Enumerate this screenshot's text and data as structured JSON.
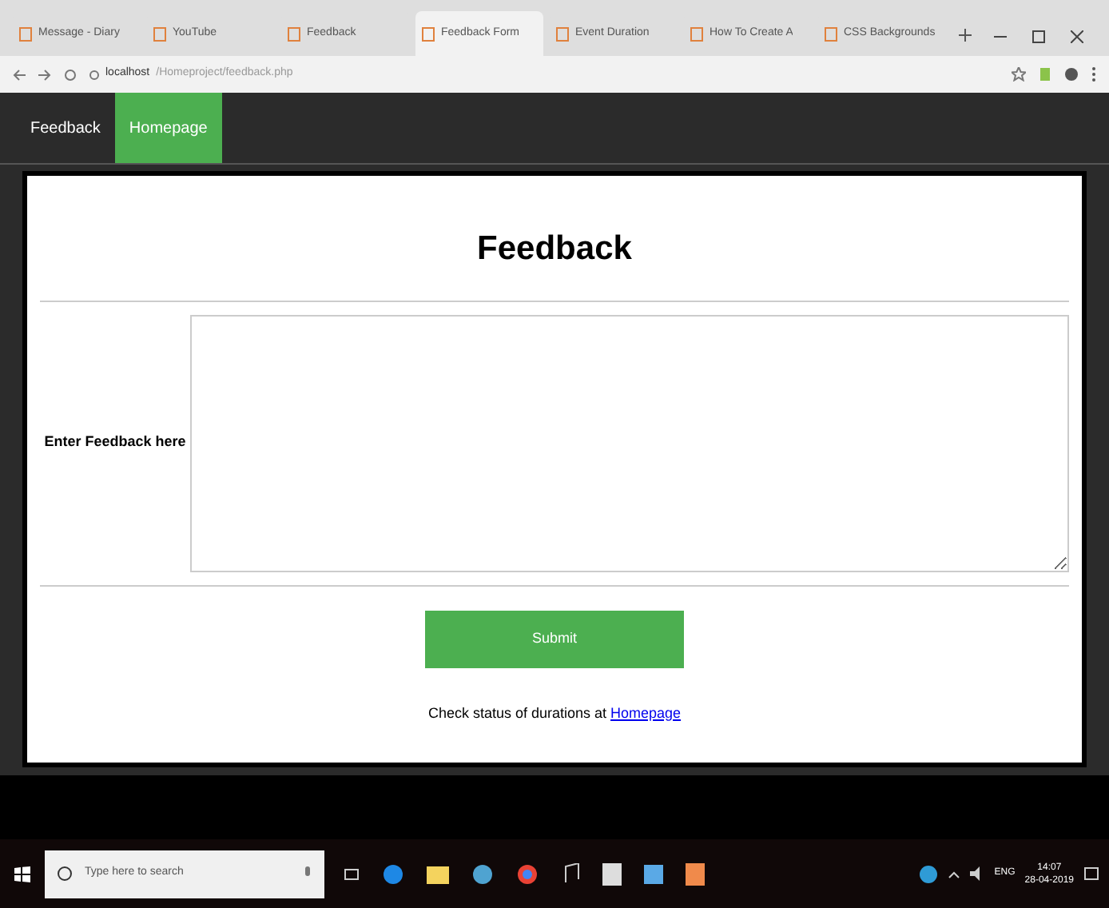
{
  "browser_tabs": [
    {
      "title": "Message - Diary",
      "selected": false
    },
    {
      "title": "YouTube",
      "selected": false
    },
    {
      "title": "Feedback",
      "selected": false
    },
    {
      "title": "Feedback Form",
      "selected": true
    },
    {
      "title": "Event Duration",
      "selected": false
    },
    {
      "title": "How To Create A",
      "selected": false
    },
    {
      "title": "CSS Backgrounds",
      "selected": false
    }
  ],
  "address_bar": {
    "host": "localhost",
    "path": "/Homeproject/feedback.php"
  },
  "nav": [
    {
      "label": "Feedback",
      "selected": false
    },
    {
      "label": "Homepage",
      "selected": true
    }
  ],
  "form": {
    "title": "Feedback",
    "label": "Enter Feedback here",
    "submit": "Submit",
    "status_text": "Check status of durations at ",
    "status_link": "Homepage"
  },
  "taskbar": {
    "search_placeholder": "Type here to search",
    "language": "ENG",
    "time": "14:07",
    "date": "28-04-2019"
  }
}
